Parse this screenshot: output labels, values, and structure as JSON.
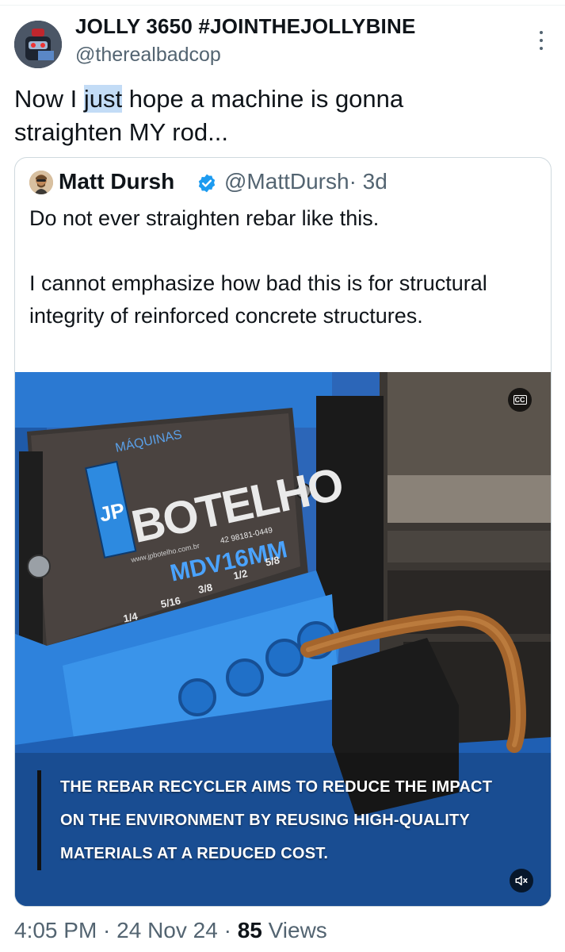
{
  "tweet": {
    "author": {
      "display_name": "JOLLY 3650 #JOINTHEJOLLYBINE",
      "handle": "@therealbadcop"
    },
    "text": {
      "line1_before": "Now I ",
      "line1_highlight": "just",
      "line1_after": " hope a machine is gonna",
      "line2": "straighten MY rod..."
    },
    "timestamp": "4:05 PM · 24 Nov 24 · ",
    "views_count": "85",
    "views_label": " Views"
  },
  "quoted_tweet": {
    "author": {
      "display_name": "Matt Dursh",
      "handle": "@MattDursh",
      "age": "· 3d",
      "verified": true
    },
    "paragraph1": "Do not ever straighten rebar like this.",
    "paragraph2": "I cannot emphasize how bad this is for structural integrity of reinforced concrete structures.",
    "video": {
      "sign_brand_top": "MÁQUINAS",
      "sign_brand_main": "BOTELHO",
      "sign_monogram": "JP",
      "sign_model": "MDV16MM",
      "sign_website": "www.jpbotelho.com.br",
      "sign_phone": "42 98181-0449",
      "sign_sizes": [
        "1/4",
        "5/16",
        "3/8",
        "1/2",
        "5/8"
      ],
      "caption_lines": [
        "THE REBAR RECYCLER AIMS TO REDUCE THE IMPACT",
        "ON THE ENVIRONMENT BY REUSING HIGH-QUALITY",
        "MATERIALS AT A REDUCED COST."
      ],
      "cc_label": "CC",
      "icons": [
        "closed-captions-icon",
        "muted-speaker-icon"
      ]
    }
  },
  "colors": {
    "text_primary": "#0f1419",
    "text_secondary": "#536471",
    "card_border": "#cfd9de",
    "verified_blue": "#1d9bf0",
    "selection_highlight": "#c3dcf6",
    "machine_blue": "#2a6fc0"
  }
}
